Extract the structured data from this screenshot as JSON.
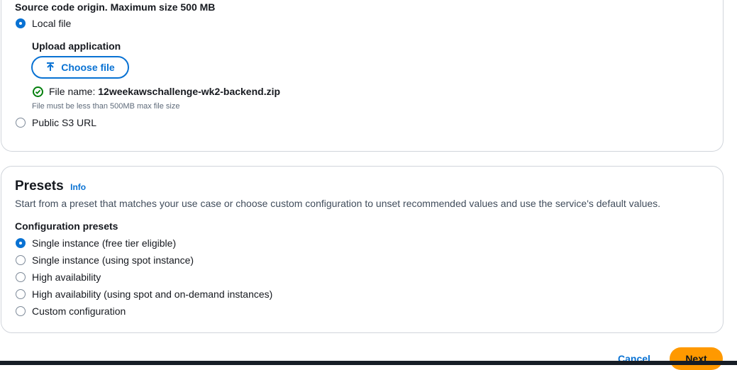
{
  "source": {
    "heading": "Source code origin. Maximum size 500 MB",
    "options": [
      "Local file",
      "Public S3 URL"
    ],
    "selected_index": 0,
    "upload_label": "Upload application",
    "choose_file_label": "Choose file",
    "file_name_prefix": "File name:",
    "file_name": "12weekawschallenge-wk2-backend.zip",
    "hint": "File must be less than 500MB max file size"
  },
  "presets": {
    "title": "Presets",
    "info_label": "Info",
    "description": "Start from a preset that matches your use case or choose custom configuration to unset recommended values and use the service's default values.",
    "config_label": "Configuration presets",
    "options": [
      "Single instance (free tier eligible)",
      "Single instance (using spot instance)",
      "High availability",
      "High availability (using spot and on-demand instances)",
      "Custom configuration"
    ],
    "selected_index": 0
  },
  "footer": {
    "cancel_label": "Cancel",
    "next_label": "Next"
  },
  "colors": {
    "accent": "#0972d3",
    "success": "#037f0c",
    "primary_button": "#ff9900"
  }
}
